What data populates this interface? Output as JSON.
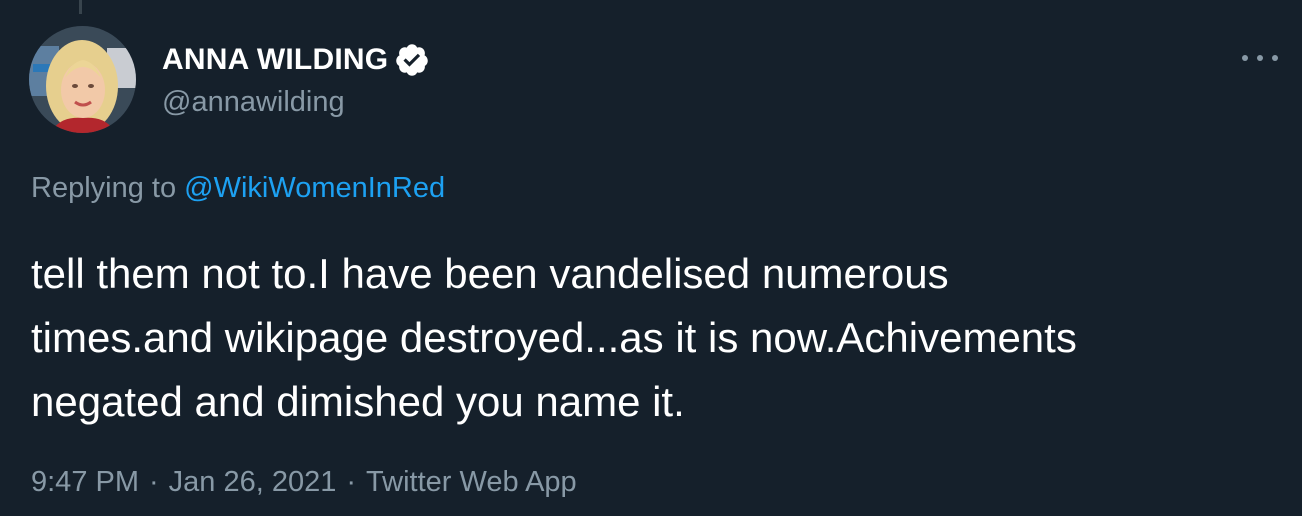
{
  "author": {
    "display_name": "ANNA WILDING",
    "handle": "@annawilding",
    "verified": true,
    "avatar_icon": "profile-photo"
  },
  "reply": {
    "prefix": "Replying to",
    "mention": "@WikiWomenInRed"
  },
  "tweet": {
    "text": "tell them not to.I have been vandelised numerous\ntimes.and wikipage destroyed...as it is now.Achivements\nnegated and dimished you name it."
  },
  "meta": {
    "time": "9:47 PM",
    "date": "Jan 26, 2021",
    "source": "Twitter Web App",
    "separator": "·"
  },
  "colors": {
    "background": "#15202b",
    "text": "#ffffff",
    "secondary": "#8899a6",
    "link": "#1da1f2"
  }
}
